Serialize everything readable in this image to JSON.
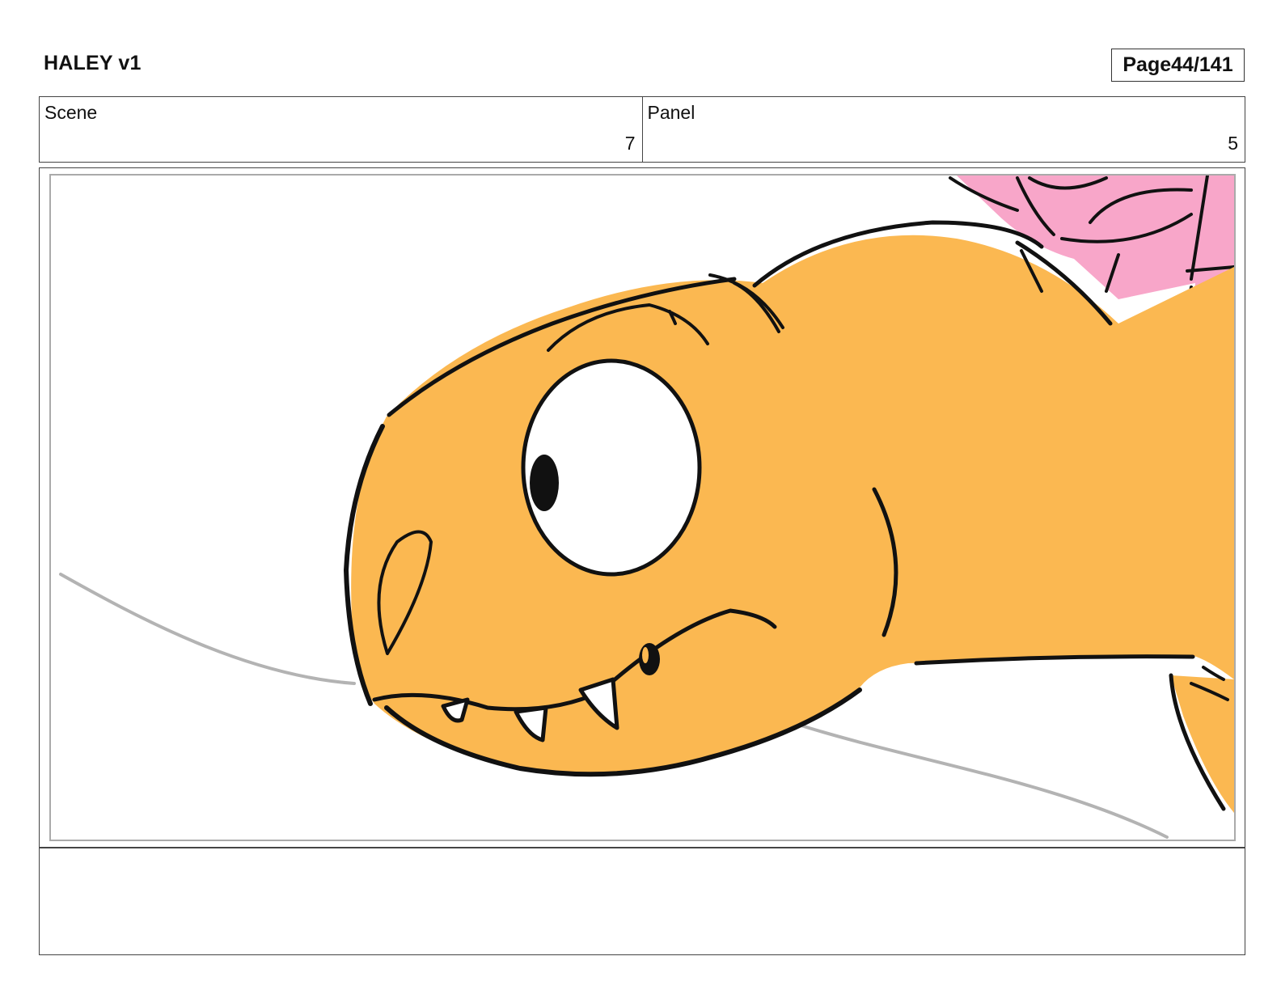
{
  "header": {
    "title": "HALEY v1",
    "page_label": "Page",
    "page_number": "44/141"
  },
  "info": {
    "scene_label": "Scene",
    "scene_value": "7",
    "panel_label": "Panel",
    "panel_value": "5"
  },
  "colors": {
    "creature_fill": "#fbb851",
    "character_fill": "#f8a6c9",
    "line": "#111111",
    "ground": "#b3b3b3"
  },
  "notes": {
    "text": ""
  }
}
